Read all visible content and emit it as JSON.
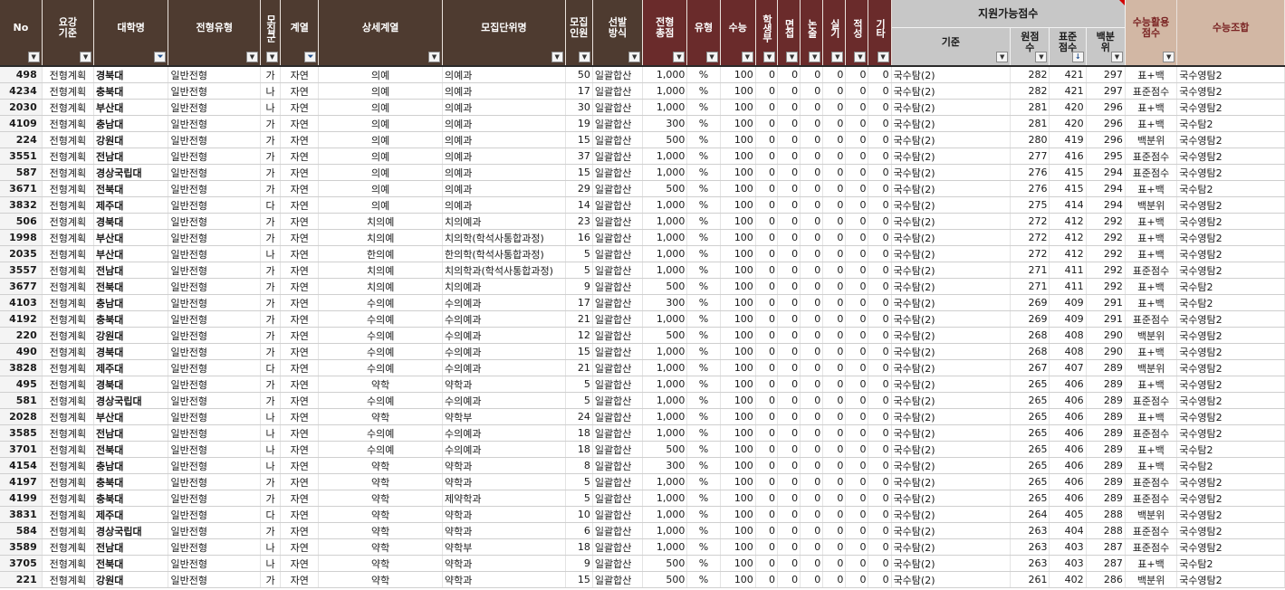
{
  "headers": {
    "no": "No",
    "yogang": "요강 기준",
    "univ": "대학명",
    "jeonhyeong": "전형유형",
    "mojip_gun": "모집군",
    "gyeyeol": "계열",
    "sangse": "상세계열",
    "mojip_danwi": "모집단위명",
    "inwon": "모집 인원",
    "seonbal": "선발 방식",
    "chongjeom": "전형 총점",
    "yuhyeong": "유형",
    "suneung": "수능",
    "haksaengbu": "학생부",
    "myeonjeop": "면접",
    "nonsul": "논술",
    "silgi": "실기",
    "jeokseong": "적성",
    "gita": "기타",
    "group_title": "지원가능점수",
    "gijun": "기준",
    "wonjeomsu": "원점수",
    "pyojun": "표준점수",
    "baekbunwi": "백분위",
    "hwalyong": "수능활용점수",
    "johap": "수능조합"
  },
  "filter_icons": {
    "dropdown": "dropdown-arrow-icon",
    "filtered": "filter-active-icon",
    "sorted": "sort-descending-icon"
  },
  "colors": {
    "header_brown": "#4e3b30",
    "header_red": "#6a2b2b",
    "header_grey": "#c7c7c7",
    "header_tan": "#d2b7a4"
  },
  "rows": [
    {
      "no": "498",
      "yogang": "전형계획",
      "univ": "경북대",
      "jh": "일반전형",
      "gun": "가",
      "gy": "자연",
      "ss": "의예",
      "unit": "의예과",
      "inwon": "50",
      "seon": "일괄합산",
      "total": "1,000",
      "type": "%",
      "sn": "100",
      "h": "0",
      "m": "0",
      "n": "0",
      "s": "0",
      "j": "0",
      "g": "0",
      "crit": "국수탐(2)",
      "won": "282",
      "pyo": "421",
      "baek": "297",
      "hw": "표+백",
      "combo": "국수영탐2"
    },
    {
      "no": "4234",
      "yogang": "전형계획",
      "univ": "충북대",
      "jh": "일반전형",
      "gun": "나",
      "gy": "자연",
      "ss": "의예",
      "unit": "의예과",
      "inwon": "17",
      "seon": "일괄합산",
      "total": "1,000",
      "type": "%",
      "sn": "100",
      "h": "0",
      "m": "0",
      "n": "0",
      "s": "0",
      "j": "0",
      "g": "0",
      "crit": "국수탐(2)",
      "won": "282",
      "pyo": "421",
      "baek": "297",
      "hw": "표준점수",
      "combo": "국수영탐2"
    },
    {
      "no": "2030",
      "yogang": "전형계획",
      "univ": "부산대",
      "jh": "일반전형",
      "gun": "나",
      "gy": "자연",
      "ss": "의예",
      "unit": "의예과",
      "inwon": "30",
      "seon": "일괄합산",
      "total": "1,000",
      "type": "%",
      "sn": "100",
      "h": "0",
      "m": "0",
      "n": "0",
      "s": "0",
      "j": "0",
      "g": "0",
      "crit": "국수탐(2)",
      "won": "281",
      "pyo": "420",
      "baek": "296",
      "hw": "표+백",
      "combo": "국수영탐2"
    },
    {
      "no": "4109",
      "yogang": "전형계획",
      "univ": "충남대",
      "jh": "일반전형",
      "gun": "가",
      "gy": "자연",
      "ss": "의예",
      "unit": "의예과",
      "inwon": "19",
      "seon": "일괄합산",
      "total": "300",
      "type": "%",
      "sn": "100",
      "h": "0",
      "m": "0",
      "n": "0",
      "s": "0",
      "j": "0",
      "g": "0",
      "crit": "국수탐(2)",
      "won": "281",
      "pyo": "420",
      "baek": "296",
      "hw": "표+백",
      "combo": "국수탐2"
    },
    {
      "no": "224",
      "yogang": "전형계획",
      "univ": "강원대",
      "jh": "일반전형",
      "gun": "가",
      "gy": "자연",
      "ss": "의예",
      "unit": "의예과",
      "inwon": "15",
      "seon": "일괄합산",
      "total": "500",
      "type": "%",
      "sn": "100",
      "h": "0",
      "m": "0",
      "n": "0",
      "s": "0",
      "j": "0",
      "g": "0",
      "crit": "국수탐(2)",
      "won": "280",
      "pyo": "419",
      "baek": "296",
      "hw": "백분위",
      "combo": "국수영탐2"
    },
    {
      "no": "3551",
      "yogang": "전형계획",
      "univ": "전남대",
      "jh": "일반전형",
      "gun": "가",
      "gy": "자연",
      "ss": "의예",
      "unit": "의예과",
      "inwon": "37",
      "seon": "일괄합산",
      "total": "1,000",
      "type": "%",
      "sn": "100",
      "h": "0",
      "m": "0",
      "n": "0",
      "s": "0",
      "j": "0",
      "g": "0",
      "crit": "국수탐(2)",
      "won": "277",
      "pyo": "416",
      "baek": "295",
      "hw": "표준점수",
      "combo": "국수영탐2"
    },
    {
      "no": "587",
      "yogang": "전형계획",
      "univ": "경상국립대",
      "jh": "일반전형",
      "gun": "가",
      "gy": "자연",
      "ss": "의예",
      "unit": "의예과",
      "inwon": "15",
      "seon": "일괄합산",
      "total": "1,000",
      "type": "%",
      "sn": "100",
      "h": "0",
      "m": "0",
      "n": "0",
      "s": "0",
      "j": "0",
      "g": "0",
      "crit": "국수탐(2)",
      "won": "276",
      "pyo": "415",
      "baek": "294",
      "hw": "표준점수",
      "combo": "국수영탐2"
    },
    {
      "no": "3671",
      "yogang": "전형계획",
      "univ": "전북대",
      "jh": "일반전형",
      "gun": "가",
      "gy": "자연",
      "ss": "의예",
      "unit": "의예과",
      "inwon": "29",
      "seon": "일괄합산",
      "total": "500",
      "type": "%",
      "sn": "100",
      "h": "0",
      "m": "0",
      "n": "0",
      "s": "0",
      "j": "0",
      "g": "0",
      "crit": "국수탐(2)",
      "won": "276",
      "pyo": "415",
      "baek": "294",
      "hw": "표+백",
      "combo": "국수탐2"
    },
    {
      "no": "3832",
      "yogang": "전형계획",
      "univ": "제주대",
      "jh": "일반전형",
      "gun": "다",
      "gy": "자연",
      "ss": "의예",
      "unit": "의예과",
      "inwon": "14",
      "seon": "일괄합산",
      "total": "1,000",
      "type": "%",
      "sn": "100",
      "h": "0",
      "m": "0",
      "n": "0",
      "s": "0",
      "j": "0",
      "g": "0",
      "crit": "국수탐(2)",
      "won": "275",
      "pyo": "414",
      "baek": "294",
      "hw": "백분위",
      "combo": "국수영탐2"
    },
    {
      "no": "506",
      "yogang": "전형계획",
      "univ": "경북대",
      "jh": "일반전형",
      "gun": "가",
      "gy": "자연",
      "ss": "치의예",
      "unit": "치의예과",
      "inwon": "23",
      "seon": "일괄합산",
      "total": "1,000",
      "type": "%",
      "sn": "100",
      "h": "0",
      "m": "0",
      "n": "0",
      "s": "0",
      "j": "0",
      "g": "0",
      "crit": "국수탐(2)",
      "won": "272",
      "pyo": "412",
      "baek": "292",
      "hw": "표+백",
      "combo": "국수영탐2"
    },
    {
      "no": "1998",
      "yogang": "전형계획",
      "univ": "부산대",
      "jh": "일반전형",
      "gun": "가",
      "gy": "자연",
      "ss": "치의예",
      "unit": "치의학(학석사통합과정)",
      "inwon": "16",
      "seon": "일괄합산",
      "total": "1,000",
      "type": "%",
      "sn": "100",
      "h": "0",
      "m": "0",
      "n": "0",
      "s": "0",
      "j": "0",
      "g": "0",
      "crit": "국수탐(2)",
      "won": "272",
      "pyo": "412",
      "baek": "292",
      "hw": "표+백",
      "combo": "국수영탐2"
    },
    {
      "no": "2035",
      "yogang": "전형계획",
      "univ": "부산대",
      "jh": "일반전형",
      "gun": "나",
      "gy": "자연",
      "ss": "한의예",
      "unit": "한의학(학석사통합과정)",
      "inwon": "5",
      "seon": "일괄합산",
      "total": "1,000",
      "type": "%",
      "sn": "100",
      "h": "0",
      "m": "0",
      "n": "0",
      "s": "0",
      "j": "0",
      "g": "0",
      "crit": "국수탐(2)",
      "won": "272",
      "pyo": "412",
      "baek": "292",
      "hw": "표+백",
      "combo": "국수영탐2"
    },
    {
      "no": "3557",
      "yogang": "전형계획",
      "univ": "전남대",
      "jh": "일반전형",
      "gun": "가",
      "gy": "자연",
      "ss": "치의예",
      "unit": "치의학과(학석사통합과정)",
      "inwon": "5",
      "seon": "일괄합산",
      "total": "1,000",
      "type": "%",
      "sn": "100",
      "h": "0",
      "m": "0",
      "n": "0",
      "s": "0",
      "j": "0",
      "g": "0",
      "crit": "국수탐(2)",
      "won": "271",
      "pyo": "411",
      "baek": "292",
      "hw": "표준점수",
      "combo": "국수영탐2"
    },
    {
      "no": "3677",
      "yogang": "전형계획",
      "univ": "전북대",
      "jh": "일반전형",
      "gun": "가",
      "gy": "자연",
      "ss": "치의예",
      "unit": "치의예과",
      "inwon": "9",
      "seon": "일괄합산",
      "total": "500",
      "type": "%",
      "sn": "100",
      "h": "0",
      "m": "0",
      "n": "0",
      "s": "0",
      "j": "0",
      "g": "0",
      "crit": "국수탐(2)",
      "won": "271",
      "pyo": "411",
      "baek": "292",
      "hw": "표+백",
      "combo": "국수탐2"
    },
    {
      "no": "4103",
      "yogang": "전형계획",
      "univ": "충남대",
      "jh": "일반전형",
      "gun": "가",
      "gy": "자연",
      "ss": "수의예",
      "unit": "수의예과",
      "inwon": "17",
      "seon": "일괄합산",
      "total": "300",
      "type": "%",
      "sn": "100",
      "h": "0",
      "m": "0",
      "n": "0",
      "s": "0",
      "j": "0",
      "g": "0",
      "crit": "국수탐(2)",
      "won": "269",
      "pyo": "409",
      "baek": "291",
      "hw": "표+백",
      "combo": "국수탐2"
    },
    {
      "no": "4192",
      "yogang": "전형계획",
      "univ": "충북대",
      "jh": "일반전형",
      "gun": "가",
      "gy": "자연",
      "ss": "수의예",
      "unit": "수의예과",
      "inwon": "21",
      "seon": "일괄합산",
      "total": "1,000",
      "type": "%",
      "sn": "100",
      "h": "0",
      "m": "0",
      "n": "0",
      "s": "0",
      "j": "0",
      "g": "0",
      "crit": "국수탐(2)",
      "won": "269",
      "pyo": "409",
      "baek": "291",
      "hw": "표준점수",
      "combo": "국수영탐2"
    },
    {
      "no": "220",
      "yogang": "전형계획",
      "univ": "강원대",
      "jh": "일반전형",
      "gun": "가",
      "gy": "자연",
      "ss": "수의예",
      "unit": "수의예과",
      "inwon": "12",
      "seon": "일괄합산",
      "total": "500",
      "type": "%",
      "sn": "100",
      "h": "0",
      "m": "0",
      "n": "0",
      "s": "0",
      "j": "0",
      "g": "0",
      "crit": "국수탐(2)",
      "won": "268",
      "pyo": "408",
      "baek": "290",
      "hw": "백분위",
      "combo": "국수영탐2"
    },
    {
      "no": "490",
      "yogang": "전형계획",
      "univ": "경북대",
      "jh": "일반전형",
      "gun": "가",
      "gy": "자연",
      "ss": "수의예",
      "unit": "수의예과",
      "inwon": "15",
      "seon": "일괄합산",
      "total": "1,000",
      "type": "%",
      "sn": "100",
      "h": "0",
      "m": "0",
      "n": "0",
      "s": "0",
      "j": "0",
      "g": "0",
      "crit": "국수탐(2)",
      "won": "268",
      "pyo": "408",
      "baek": "290",
      "hw": "표+백",
      "combo": "국수영탐2"
    },
    {
      "no": "3828",
      "yogang": "전형계획",
      "univ": "제주대",
      "jh": "일반전형",
      "gun": "다",
      "gy": "자연",
      "ss": "수의예",
      "unit": "수의예과",
      "inwon": "21",
      "seon": "일괄합산",
      "total": "1,000",
      "type": "%",
      "sn": "100",
      "h": "0",
      "m": "0",
      "n": "0",
      "s": "0",
      "j": "0",
      "g": "0",
      "crit": "국수탐(2)",
      "won": "267",
      "pyo": "407",
      "baek": "289",
      "hw": "백분위",
      "combo": "국수영탐2"
    },
    {
      "no": "495",
      "yogang": "전형계획",
      "univ": "경북대",
      "jh": "일반전형",
      "gun": "가",
      "gy": "자연",
      "ss": "약학",
      "unit": "약학과",
      "inwon": "5",
      "seon": "일괄합산",
      "total": "1,000",
      "type": "%",
      "sn": "100",
      "h": "0",
      "m": "0",
      "n": "0",
      "s": "0",
      "j": "0",
      "g": "0",
      "crit": "국수탐(2)",
      "won": "265",
      "pyo": "406",
      "baek": "289",
      "hw": "표+백",
      "combo": "국수영탐2"
    },
    {
      "no": "581",
      "yogang": "전형계획",
      "univ": "경상국립대",
      "jh": "일반전형",
      "gun": "가",
      "gy": "자연",
      "ss": "수의예",
      "unit": "수의예과",
      "inwon": "5",
      "seon": "일괄합산",
      "total": "1,000",
      "type": "%",
      "sn": "100",
      "h": "0",
      "m": "0",
      "n": "0",
      "s": "0",
      "j": "0",
      "g": "0",
      "crit": "국수탐(2)",
      "won": "265",
      "pyo": "406",
      "baek": "289",
      "hw": "표준점수",
      "combo": "국수영탐2"
    },
    {
      "no": "2028",
      "yogang": "전형계획",
      "univ": "부산대",
      "jh": "일반전형",
      "gun": "나",
      "gy": "자연",
      "ss": "약학",
      "unit": "약학부",
      "inwon": "24",
      "seon": "일괄합산",
      "total": "1,000",
      "type": "%",
      "sn": "100",
      "h": "0",
      "m": "0",
      "n": "0",
      "s": "0",
      "j": "0",
      "g": "0",
      "crit": "국수탐(2)",
      "won": "265",
      "pyo": "406",
      "baek": "289",
      "hw": "표+백",
      "combo": "국수영탐2"
    },
    {
      "no": "3585",
      "yogang": "전형계획",
      "univ": "전남대",
      "jh": "일반전형",
      "gun": "나",
      "gy": "자연",
      "ss": "수의예",
      "unit": "수의예과",
      "inwon": "18",
      "seon": "일괄합산",
      "total": "1,000",
      "type": "%",
      "sn": "100",
      "h": "0",
      "m": "0",
      "n": "0",
      "s": "0",
      "j": "0",
      "g": "0",
      "crit": "국수탐(2)",
      "won": "265",
      "pyo": "406",
      "baek": "289",
      "hw": "표준점수",
      "combo": "국수영탐2"
    },
    {
      "no": "3701",
      "yogang": "전형계획",
      "univ": "전북대",
      "jh": "일반전형",
      "gun": "나",
      "gy": "자연",
      "ss": "수의예",
      "unit": "수의예과",
      "inwon": "18",
      "seon": "일괄합산",
      "total": "500",
      "type": "%",
      "sn": "100",
      "h": "0",
      "m": "0",
      "n": "0",
      "s": "0",
      "j": "0",
      "g": "0",
      "crit": "국수탐(2)",
      "won": "265",
      "pyo": "406",
      "baek": "289",
      "hw": "표+백",
      "combo": "국수탐2"
    },
    {
      "no": "4154",
      "yogang": "전형계획",
      "univ": "충남대",
      "jh": "일반전형",
      "gun": "나",
      "gy": "자연",
      "ss": "약학",
      "unit": "약학과",
      "inwon": "8",
      "seon": "일괄합산",
      "total": "300",
      "type": "%",
      "sn": "100",
      "h": "0",
      "m": "0",
      "n": "0",
      "s": "0",
      "j": "0",
      "g": "0",
      "crit": "국수탐(2)",
      "won": "265",
      "pyo": "406",
      "baek": "289",
      "hw": "표+백",
      "combo": "국수탐2"
    },
    {
      "no": "4197",
      "yogang": "전형계획",
      "univ": "충북대",
      "jh": "일반전형",
      "gun": "가",
      "gy": "자연",
      "ss": "약학",
      "unit": "약학과",
      "inwon": "5",
      "seon": "일괄합산",
      "total": "1,000",
      "type": "%",
      "sn": "100",
      "h": "0",
      "m": "0",
      "n": "0",
      "s": "0",
      "j": "0",
      "g": "0",
      "crit": "국수탐(2)",
      "won": "265",
      "pyo": "406",
      "baek": "289",
      "hw": "표준점수",
      "combo": "국수영탐2"
    },
    {
      "no": "4199",
      "yogang": "전형계획",
      "univ": "충북대",
      "jh": "일반전형",
      "gun": "가",
      "gy": "자연",
      "ss": "약학",
      "unit": "제약학과",
      "inwon": "5",
      "seon": "일괄합산",
      "total": "1,000",
      "type": "%",
      "sn": "100",
      "h": "0",
      "m": "0",
      "n": "0",
      "s": "0",
      "j": "0",
      "g": "0",
      "crit": "국수탐(2)",
      "won": "265",
      "pyo": "406",
      "baek": "289",
      "hw": "표준점수",
      "combo": "국수영탐2"
    },
    {
      "no": "3831",
      "yogang": "전형계획",
      "univ": "제주대",
      "jh": "일반전형",
      "gun": "다",
      "gy": "자연",
      "ss": "약학",
      "unit": "약학과",
      "inwon": "10",
      "seon": "일괄합산",
      "total": "1,000",
      "type": "%",
      "sn": "100",
      "h": "0",
      "m": "0",
      "n": "0",
      "s": "0",
      "j": "0",
      "g": "0",
      "crit": "국수탐(2)",
      "won": "264",
      "pyo": "405",
      "baek": "288",
      "hw": "백분위",
      "combo": "국수영탐2"
    },
    {
      "no": "584",
      "yogang": "전형계획",
      "univ": "경상국립대",
      "jh": "일반전형",
      "gun": "가",
      "gy": "자연",
      "ss": "약학",
      "unit": "약학과",
      "inwon": "6",
      "seon": "일괄합산",
      "total": "1,000",
      "type": "%",
      "sn": "100",
      "h": "0",
      "m": "0",
      "n": "0",
      "s": "0",
      "j": "0",
      "g": "0",
      "crit": "국수탐(2)",
      "won": "263",
      "pyo": "404",
      "baek": "288",
      "hw": "표준점수",
      "combo": "국수영탐2"
    },
    {
      "no": "3589",
      "yogang": "전형계획",
      "univ": "전남대",
      "jh": "일반전형",
      "gun": "나",
      "gy": "자연",
      "ss": "약학",
      "unit": "약학부",
      "inwon": "18",
      "seon": "일괄합산",
      "total": "1,000",
      "type": "%",
      "sn": "100",
      "h": "0",
      "m": "0",
      "n": "0",
      "s": "0",
      "j": "0",
      "g": "0",
      "crit": "국수탐(2)",
      "won": "263",
      "pyo": "403",
      "baek": "287",
      "hw": "표준점수",
      "combo": "국수영탐2"
    },
    {
      "no": "3705",
      "yogang": "전형계획",
      "univ": "전북대",
      "jh": "일반전형",
      "gun": "나",
      "gy": "자연",
      "ss": "약학",
      "unit": "약학과",
      "inwon": "9",
      "seon": "일괄합산",
      "total": "500",
      "type": "%",
      "sn": "100",
      "h": "0",
      "m": "0",
      "n": "0",
      "s": "0",
      "j": "0",
      "g": "0",
      "crit": "국수탐(2)",
      "won": "263",
      "pyo": "403",
      "baek": "287",
      "hw": "표+백",
      "combo": "국수탐2"
    },
    {
      "no": "221",
      "yogang": "전형계획",
      "univ": "강원대",
      "jh": "일반전형",
      "gun": "가",
      "gy": "자연",
      "ss": "약학",
      "unit": "약학과",
      "inwon": "15",
      "seon": "일괄합산",
      "total": "500",
      "type": "%",
      "sn": "100",
      "h": "0",
      "m": "0",
      "n": "0",
      "s": "0",
      "j": "0",
      "g": "0",
      "crit": "국수탐(2)",
      "won": "261",
      "pyo": "402",
      "baek": "286",
      "hw": "백분위",
      "combo": "국수영탐2"
    }
  ]
}
